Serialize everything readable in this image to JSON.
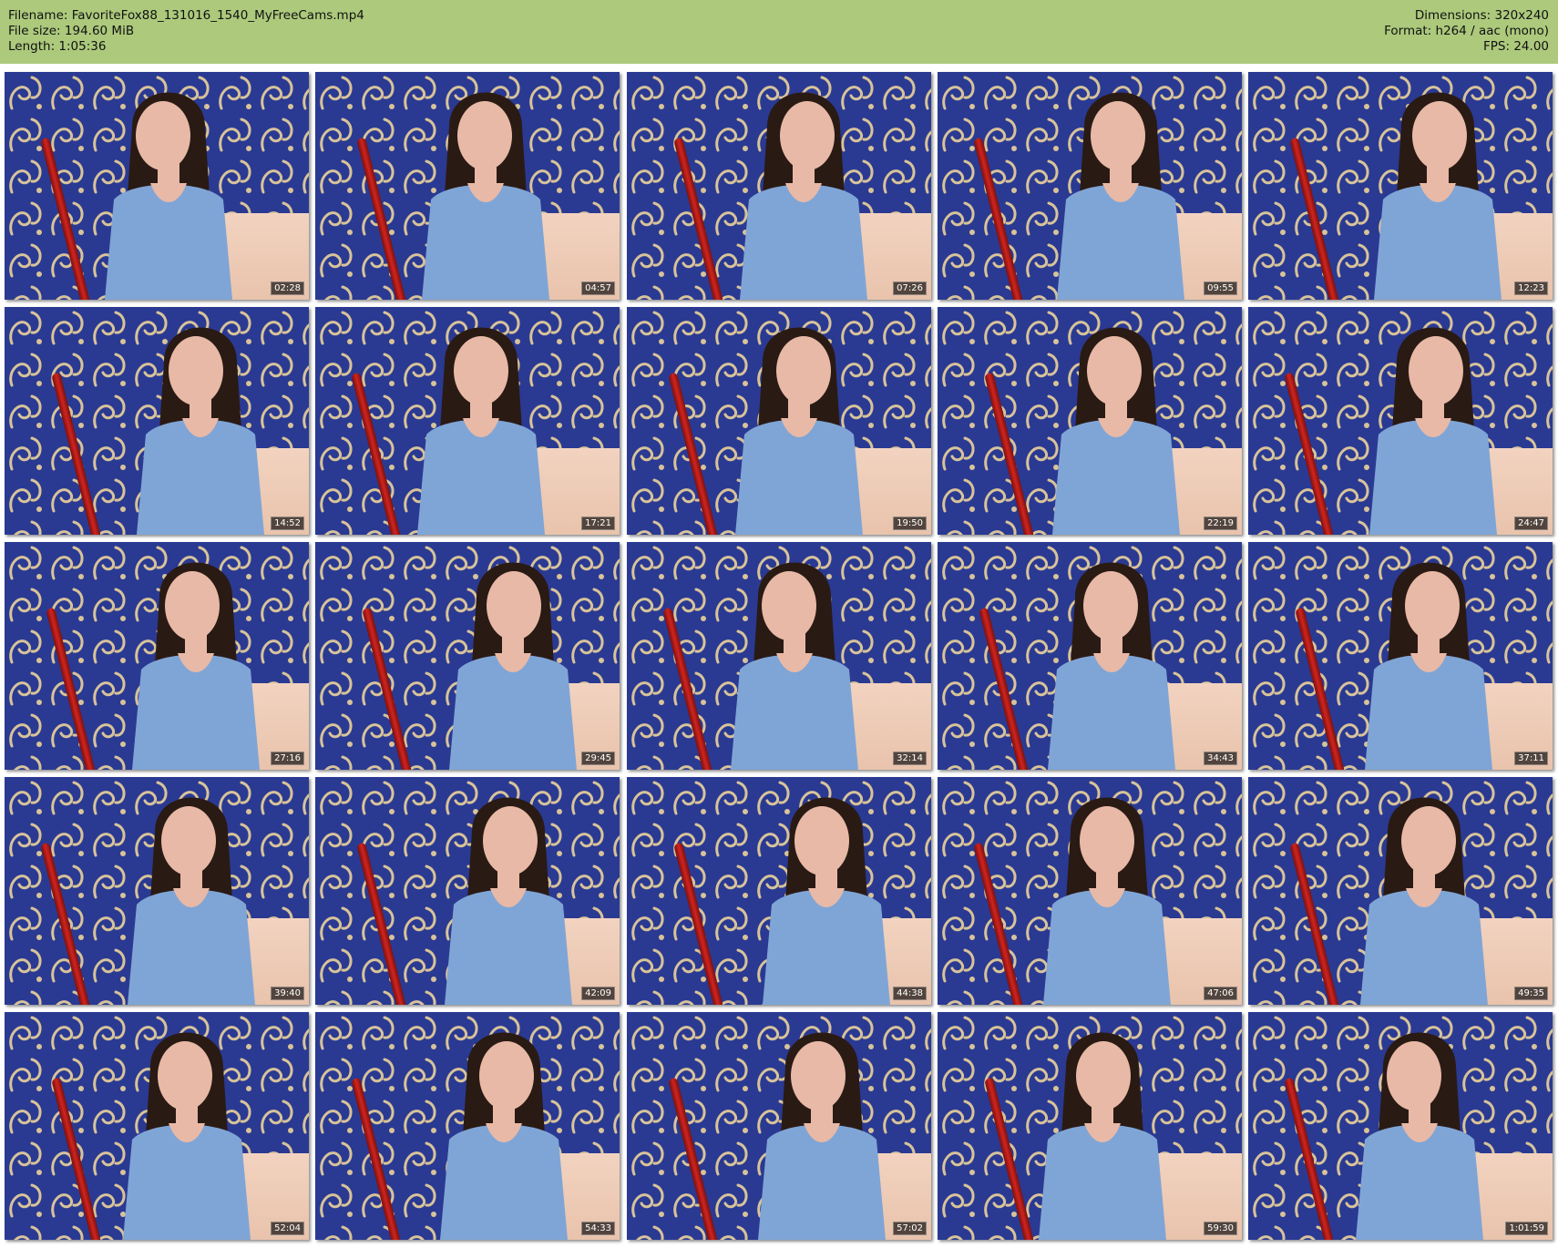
{
  "header": {
    "filename": "Filename: FavoriteFox88_131016_1540_MyFreeCams.mp4",
    "file_size": "File size: 194.60 MiB",
    "length": "Length: 1:05:36",
    "dimensions": "Dimensions: 320x240",
    "format": "Format: h264 / aac (mono)",
    "fps": "FPS: 24.00"
  },
  "colors": {
    "header_bg": "#acc97c",
    "wallpaper_blue": "#2a3a92",
    "wallpaper_pattern": "#d8c39a",
    "shirt": "#7fa5d6",
    "hair": "#2a1a14",
    "skin": "#e8b9a6"
  },
  "thumbnails": [
    {
      "timestamp": "02:28"
    },
    {
      "timestamp": "04:57"
    },
    {
      "timestamp": "07:26"
    },
    {
      "timestamp": "09:55"
    },
    {
      "timestamp": "12:23"
    },
    {
      "timestamp": "14:52"
    },
    {
      "timestamp": "17:21"
    },
    {
      "timestamp": "19:50"
    },
    {
      "timestamp": "22:19"
    },
    {
      "timestamp": "24:47"
    },
    {
      "timestamp": "27:16"
    },
    {
      "timestamp": "29:45"
    },
    {
      "timestamp": "32:14"
    },
    {
      "timestamp": "34:43"
    },
    {
      "timestamp": "37:11"
    },
    {
      "timestamp": "39:40"
    },
    {
      "timestamp": "42:09"
    },
    {
      "timestamp": "44:38"
    },
    {
      "timestamp": "47:06"
    },
    {
      "timestamp": "49:35"
    },
    {
      "timestamp": "52:04"
    },
    {
      "timestamp": "54:33"
    },
    {
      "timestamp": "57:02"
    },
    {
      "timestamp": "59:30"
    },
    {
      "timestamp": "1:01:59"
    }
  ]
}
